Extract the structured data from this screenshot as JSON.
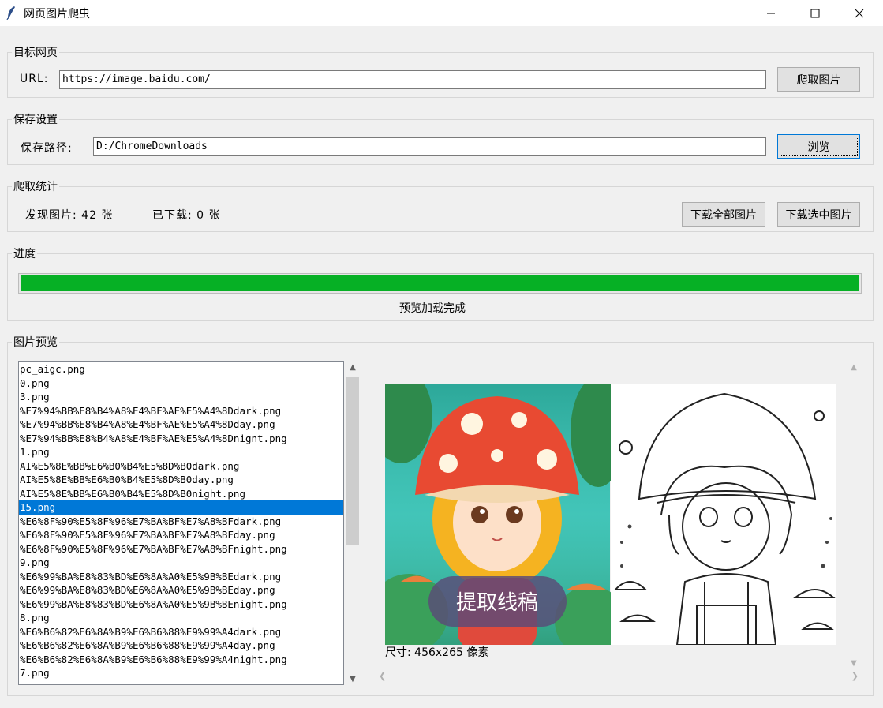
{
  "window": {
    "title": "网页图片爬虫",
    "icons": {
      "app": "feather-icon",
      "minimize": "minimize-icon",
      "maximize": "maximize-icon",
      "close": "close-icon"
    }
  },
  "target": {
    "group_label": "目标网页",
    "url_label": "URL:",
    "url_value": "https://image.baidu.com/",
    "crawl_button": "爬取图片"
  },
  "save": {
    "group_label": "保存设置",
    "path_label": "保存路径:",
    "path_value": "D:/ChromeDownloads",
    "browse_button": "浏览"
  },
  "stats": {
    "group_label": "爬取统计",
    "found_text": "发现图片: 42 张",
    "downloaded_text": "已下载: 0 张",
    "download_all_button": "下载全部图片",
    "download_selected_button": "下载选中图片"
  },
  "progress": {
    "group_label": "进度",
    "value": 1.0,
    "status_text": "预览加载完成",
    "fill_color": "#06b025"
  },
  "preview": {
    "group_label": "图片预览",
    "selected_index": 10,
    "files": [
      "pc_aigc.png",
      "0.png",
      "3.png",
      "%E7%94%BB%E8%B4%A8%E4%BF%AE%E5%A4%8Ddark.png",
      "%E7%94%BB%E8%B4%A8%E4%BF%AE%E5%A4%8Dday.png",
      "%E7%94%BB%E8%B4%A8%E4%BF%AE%E5%A4%8Dnignt.png",
      "1.png",
      "AI%E5%8E%BB%E6%B0%B4%E5%8D%B0dark.png",
      "AI%E5%8E%BB%E6%B0%B4%E5%8D%B0day.png",
      "AI%E5%8E%BB%E6%B0%B4%E5%8D%B0night.png",
      "15.png",
      "%E6%8F%90%E5%8F%96%E7%BA%BF%E7%A8%BFdark.png",
      "%E6%8F%90%E5%8F%96%E7%BA%BF%E7%A8%BFday.png",
      "%E6%8F%90%E5%8F%96%E7%BA%BF%E7%A8%BFnight.png",
      "9.png",
      "%E6%99%BA%E8%83%BD%E6%8A%A0%E5%9B%BEdark.png",
      "%E6%99%BA%E8%83%BD%E6%8A%A0%E5%9B%BEday.png",
      "%E6%99%BA%E8%83%BD%E6%8A%A0%E5%9B%BEnight.png",
      "8.png",
      "%E6%B6%82%E6%8A%B9%E6%B6%88%E9%99%A4dark.png",
      "%E6%B6%82%E6%8A%B9%E6%B6%88%E9%99%A4day.png",
      "%E6%B6%82%E6%8A%B9%E6%B6%88%E9%99%A4night.png",
      "7.png"
    ],
    "image_caption": "提取线稿",
    "size_text": "尺寸: 456x265 像素"
  }
}
